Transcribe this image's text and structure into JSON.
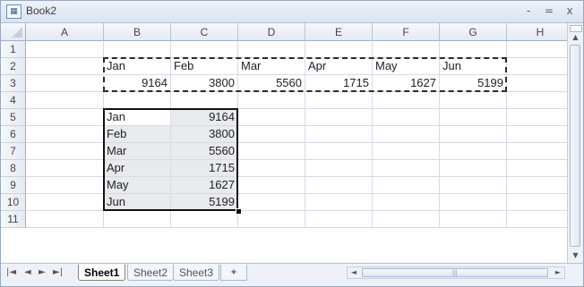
{
  "window": {
    "title": "Book2",
    "app_icon": "excel-doc-icon",
    "buttons": [
      "-",
      "=",
      "x"
    ]
  },
  "columns": [
    "A",
    "B",
    "C",
    "D",
    "E",
    "F",
    "G",
    "H"
  ],
  "rows": [
    "1",
    "2",
    "3",
    "4",
    "5",
    "6",
    "7",
    "8",
    "9",
    "10",
    "11"
  ],
  "cells": {
    "B2": "Jan",
    "C2": "Feb",
    "D2": "Mar",
    "E2": "Apr",
    "F2": "May",
    "G2": "Jun",
    "B3": "9164",
    "C3": "3800",
    "D3": "5560",
    "E3": "1715",
    "F3": "1627",
    "G3": "5199",
    "B5": "Jan",
    "C5": "9164",
    "B6": "Feb",
    "C6": "3800",
    "B7": "Mar",
    "C7": "5560",
    "B8": "Apr",
    "C8": "1715",
    "B9": "May",
    "C9": "1627",
    "B10": "Jun",
    "C10": "5199"
  },
  "copy_marquee_range": "B2:G3",
  "selected_range": "B5:C10",
  "sheet_tabs": [
    {
      "label": "Sheet1",
      "active": true
    },
    {
      "label": "Sheet2",
      "active": false
    },
    {
      "label": "Sheet3",
      "active": false
    }
  ],
  "sheet_nav": [
    "|◄",
    "◄",
    "►",
    "►|"
  ],
  "colors": {
    "titlebar": "#d9e3f0",
    "header_bg": "#e4eaf3",
    "gridline": "#d5dbe5",
    "selection_shade": "#e8eaee"
  }
}
